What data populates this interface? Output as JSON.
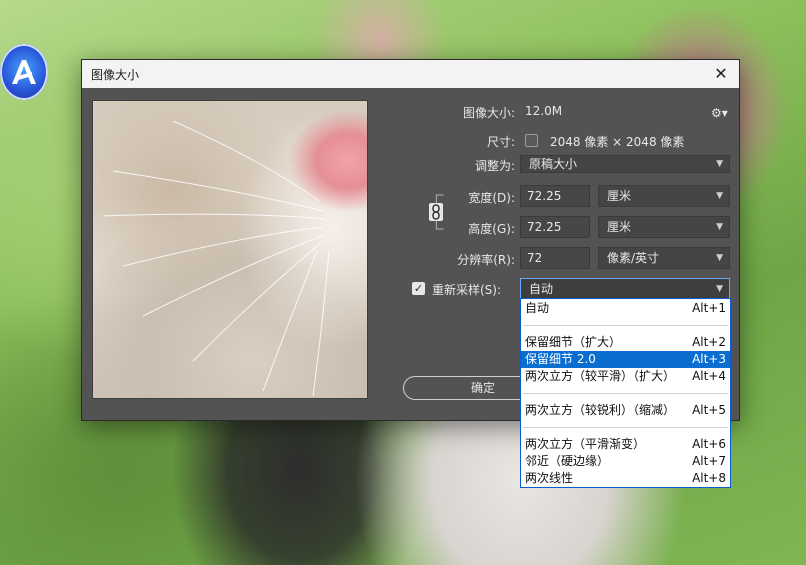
{
  "dialog": {
    "title": "图像大小",
    "close_glyph": "✕"
  },
  "info": {
    "image_size_label": "图像大小:",
    "image_size_value": "12.0M",
    "gear_glyph": "⚙▾",
    "dimensions_label": "尺寸:",
    "dimensions_value": "2048 像素 × 2048 像素",
    "fit_label": "调整为:",
    "fit_value": "原稿大小"
  },
  "fields": {
    "width_label": "宽度(D):",
    "width_value": "72.25",
    "width_unit": "厘米",
    "height_label": "高度(G):",
    "height_value": "72.25",
    "height_unit": "厘米",
    "resolution_label": "分辨率(R):",
    "resolution_value": "72",
    "resolution_unit": "像素/英寸"
  },
  "resample": {
    "label": "重新采样(S):",
    "checked_glyph": "✓",
    "value": "自动"
  },
  "buttons": {
    "ok": "确定"
  },
  "resample_menu": [
    {
      "label": "自动",
      "key": "Alt+1"
    },
    {
      "label": "保留细节（扩大）",
      "key": "Alt+2"
    },
    {
      "label": "保留细节 2.0",
      "key": "Alt+3",
      "selected": true
    },
    {
      "label": "两次立方（较平滑）（扩大）",
      "key": "Alt+4"
    },
    {
      "label": "两次立方（较锐利）（缩减）",
      "key": "Alt+5"
    },
    {
      "label": "两次立方（平滑渐变）",
      "key": "Alt+6"
    },
    {
      "label": "邻近（硬边缘）",
      "key": "Alt+7"
    },
    {
      "label": "两次线性",
      "key": "Alt+8"
    }
  ],
  "colors": {
    "dialog_bg": "#535353",
    "titlebar_bg": "#f3f3f3",
    "menu_selected": "#0a6ed1",
    "focus_border": "#6aa8ff"
  }
}
